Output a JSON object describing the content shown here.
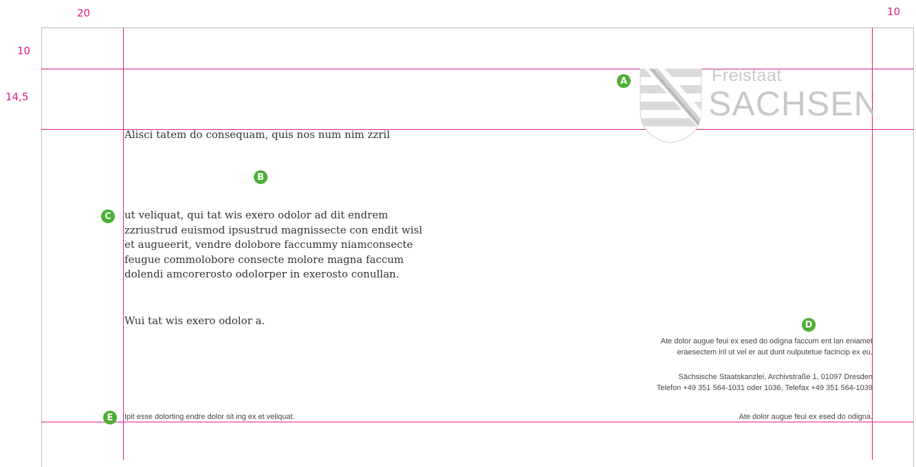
{
  "margins": {
    "left": "20",
    "right": "10",
    "top": "10",
    "header": "14,5"
  },
  "markers": {
    "a": "A",
    "b": "B",
    "c": "C",
    "d": "D",
    "e": "E"
  },
  "logo": {
    "top": "Freistaat",
    "main": "SACHSEN"
  },
  "letter": {
    "subject": "Alisci tatem do consequam, quis nos num nim zzril",
    "body_lines": [
      "ut veliquat, qui tat wis exero odolor ad dit endrem",
      "zzriustrud euismod ipsustrud magnissecte con endit wisl",
      "et augueerit, vendre dolobore faccummy niamconsecte",
      "feugue commolobore consecte molore magna faccum",
      "dolendi amcorerosto odolorper in exerosto conullan."
    ],
    "closing": "Wui tat wis exero odolor a."
  },
  "sender": {
    "line1": "Ate dolor augue feui ex esed do odigna faccum ent lan eniamet",
    "line2": "eraesectem iril ut vel er aut dunt nulputetue facincip ex eu.",
    "address": "Sächsische Staatskanzlei, Archivstraße 1, 01097 Dresden",
    "phone": "Telefon +49 351 564-1031 oder 1036, Telefax +49 351 564-1039"
  },
  "footer": {
    "left": "Ipit esse dolorting endre dolor sit ing ex et veliquat.",
    "right": "Ate dolor augue feui ex esed do odigna."
  },
  "colors": {
    "guide": "#e0198c",
    "marker": "#4caf35",
    "logo": "#c8c8c8"
  }
}
